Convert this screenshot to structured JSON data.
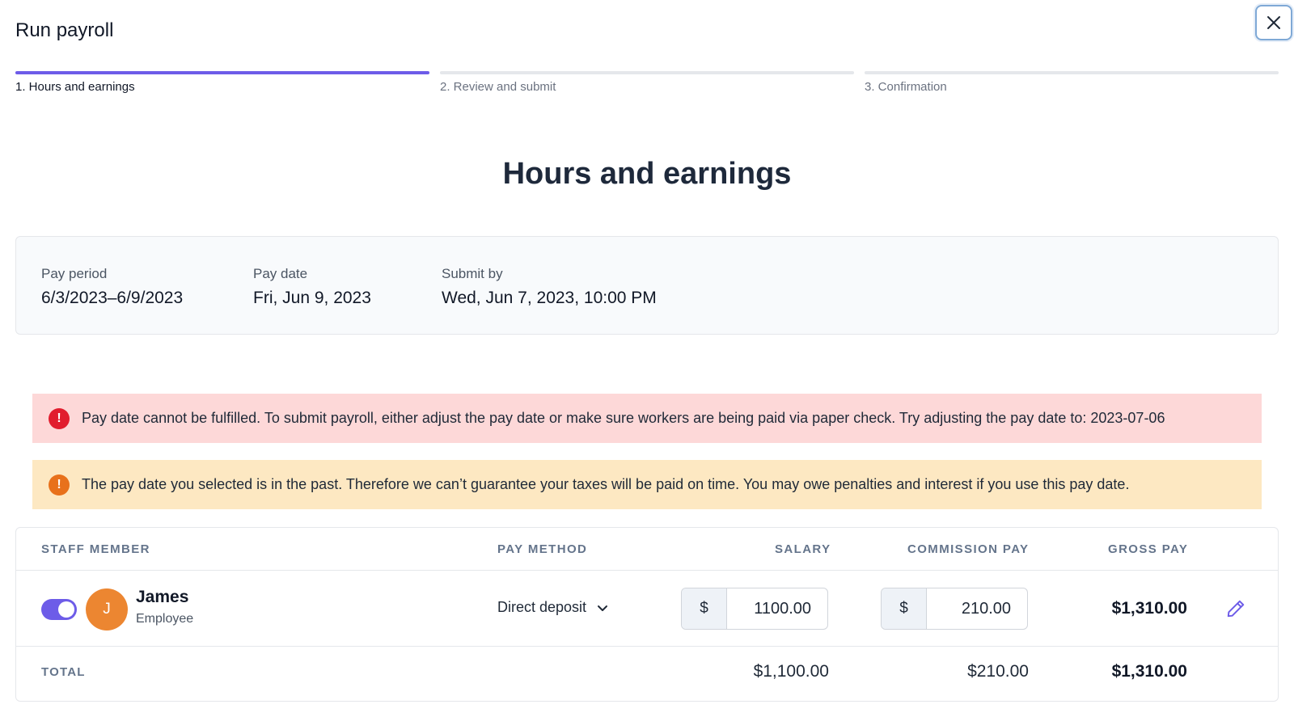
{
  "header": {
    "title": "Run payroll",
    "close_icon": "close-icon"
  },
  "stepper": {
    "steps": [
      {
        "label": "1. Hours and earnings",
        "active": true
      },
      {
        "label": "2. Review and submit",
        "active": false
      },
      {
        "label": "3. Confirmation",
        "active": false
      }
    ]
  },
  "main": {
    "heading": "Hours and earnings"
  },
  "pay_info": {
    "period_label": "Pay period",
    "period_value": "6/3/2023–6/9/2023",
    "date_label": "Pay date",
    "date_value": "Fri, Jun 9, 2023",
    "submit_label": "Submit by",
    "submit_value": "Wed, Jun 7, 2023, 10:00 PM"
  },
  "alerts": {
    "error": {
      "icon": "!",
      "text": "Pay date cannot be fulfilled. To submit payroll, either adjust the pay date or make sure workers are being paid via paper check. Try adjusting the pay date to: 2023-07-06"
    },
    "warning": {
      "icon": "!",
      "text": "The pay date you selected is in the past. Therefore we can’t guarantee your taxes will be paid on time. You may owe penalties and interest if you use this pay date."
    }
  },
  "table": {
    "headers": {
      "staff": "STAFF MEMBER",
      "method": "PAY METHOD",
      "salary": "SALARY",
      "commission": "COMMISSION PAY",
      "gross": "GROSS PAY"
    },
    "rows": [
      {
        "initial": "J",
        "name": "James",
        "role": "Employee",
        "enabled": true,
        "pay_method": "Direct deposit",
        "currency": "$",
        "salary": "1100.00",
        "commission": "210.00",
        "gross": "$1,310.00"
      }
    ],
    "totals": {
      "label": "TOTAL",
      "salary": "$1,100.00",
      "commission": "$210.00",
      "gross": "$1,310.00"
    }
  },
  "colors": {
    "accent": "#6d5ce8",
    "error_bg": "#fdd8d8",
    "warning_bg": "#fde8c2",
    "avatar": "#ec8631"
  }
}
